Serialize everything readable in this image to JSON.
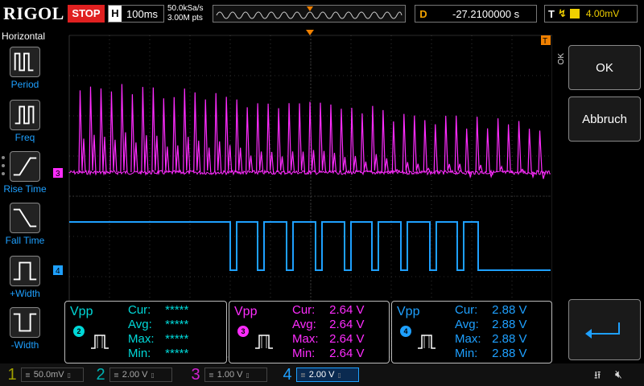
{
  "topbar": {
    "brand": "RIGOL",
    "run_state": "STOP",
    "horizontal_key": "H",
    "timebase": "100ms",
    "sample_rate": "50.0kSa/s",
    "memory_depth": "3.00M pts",
    "delay_key": "D",
    "delay_value": "-27.2100000 s",
    "trigger_key": "T",
    "trigger_level": "4.00mV"
  },
  "left_menu": {
    "title": "Horizontal",
    "items": [
      {
        "label": "Period",
        "icon": "period-pulse-icon"
      },
      {
        "label": "Freq",
        "icon": "freq-pulse-icon"
      },
      {
        "label": "Rise Time",
        "icon": "rise-edge-icon"
      },
      {
        "label": "Fall Time",
        "icon": "fall-edge-icon"
      },
      {
        "label": "+Width",
        "icon": "positive-width-icon"
      },
      {
        "label": "-Width",
        "icon": "negative-width-icon"
      }
    ]
  },
  "right_menu": {
    "side_label": "OK",
    "ok_label": "OK",
    "cancel_label": "Abbruch",
    "enter_icon": "enter-arrow-icon"
  },
  "measurements": [
    {
      "name": "Vpp",
      "channel": "2",
      "color": "#00d8d8",
      "cur_label": "Cur:",
      "cur": "*****",
      "avg_label": "Avg:",
      "avg": "*****",
      "max_label": "Max:",
      "max": "*****",
      "min_label": "Min:",
      "min": "*****"
    },
    {
      "name": "Vpp",
      "channel": "3",
      "color": "#ff2cff",
      "cur_label": "Cur:",
      "cur": "2.64 V",
      "avg_label": "Avg:",
      "avg": "2.64 V",
      "max_label": "Max:",
      "max": "2.64 V",
      "min_label": "Min:",
      "min": "2.64 V"
    },
    {
      "name": "Vpp",
      "channel": "4",
      "color": "#1ea0ff",
      "cur_label": "Cur:",
      "cur": "2.88 V",
      "avg_label": "Avg:",
      "avg": "2.88 V",
      "max_label": "Max:",
      "max": "2.88 V",
      "min_label": "Min:",
      "min": "2.88 V"
    }
  ],
  "channels": [
    {
      "num": "1",
      "scale": "50.0mV",
      "color": "#a0a000",
      "active": false
    },
    {
      "num": "2",
      "scale": "2.00 V",
      "color": "#00b0b0",
      "active": false
    },
    {
      "num": "3",
      "scale": "1.00 V",
      "color": "#d020d0",
      "active": false
    },
    {
      "num": "4",
      "scale": "2.00 V",
      "color": "#1ea0ff",
      "active": true
    }
  ],
  "markers": {
    "ch3": "3",
    "ch4": "4",
    "trigger": "T"
  },
  "colors": {
    "ch3": "#ff2cff",
    "ch4": "#1ea0ff",
    "trigger_marker": "#f08000",
    "grid": "#555555"
  },
  "waveforms": {
    "ch3_spike_count": 45,
    "ch4_pulses": 9
  },
  "status_icons": {
    "usb": "usb-icon",
    "speaker": "speaker-muted-icon"
  }
}
